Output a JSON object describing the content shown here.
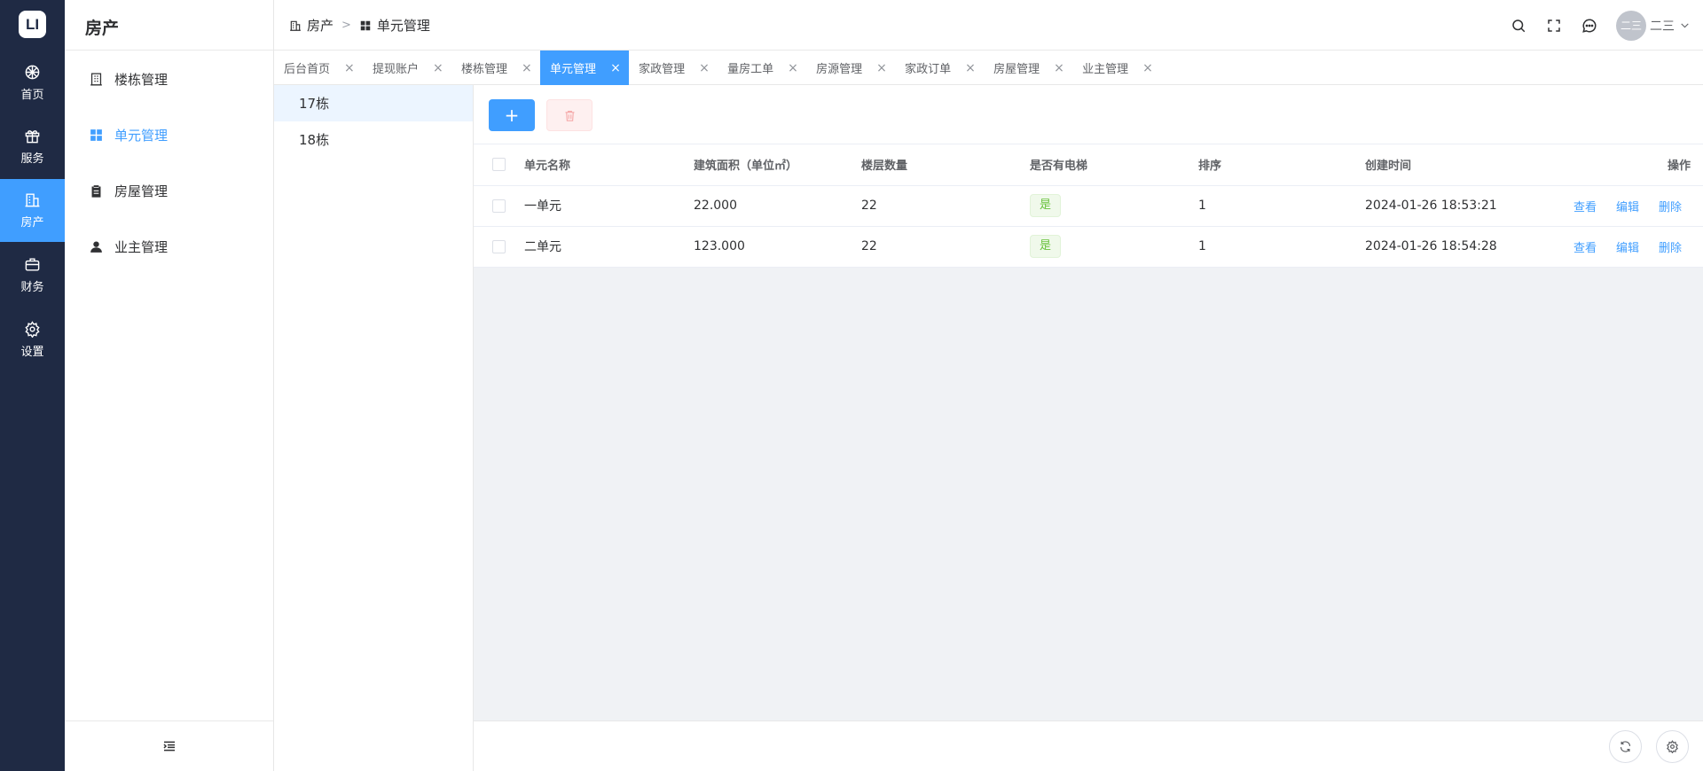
{
  "rail": {
    "logo": "LI",
    "items": [
      {
        "label": "首页",
        "icon": "dashboard-icon"
      },
      {
        "label": "服务",
        "icon": "gift-icon"
      },
      {
        "label": "房产",
        "icon": "building-icon"
      },
      {
        "label": "财务",
        "icon": "briefcase-icon"
      },
      {
        "label": "设置",
        "icon": "gear-icon"
      }
    ]
  },
  "sidebar": {
    "title": "房产",
    "items": [
      {
        "label": "楼栋管理",
        "icon": "office-building-icon"
      },
      {
        "label": "单元管理",
        "icon": "grid-icon"
      },
      {
        "label": "房屋管理",
        "icon": "clipboard-icon"
      },
      {
        "label": "业主管理",
        "icon": "person-icon"
      }
    ]
  },
  "header": {
    "breadcrumb": [
      "房产",
      "单元管理"
    ],
    "user_avatar_text": "二三",
    "user_name": "二三"
  },
  "tabs": [
    {
      "label": "后台首页"
    },
    {
      "label": "提现账户"
    },
    {
      "label": "楼栋管理"
    },
    {
      "label": "单元管理"
    },
    {
      "label": "家政管理"
    },
    {
      "label": "量房工单"
    },
    {
      "label": "房源管理"
    },
    {
      "label": "家政订单"
    },
    {
      "label": "房屋管理"
    },
    {
      "label": "业主管理"
    }
  ],
  "tree": [
    "17栋",
    "18栋"
  ],
  "toolbar": {
    "add_label": "+"
  },
  "table": {
    "columns": [
      "单元名称",
      "建筑面积（单位㎡）",
      "楼层数量",
      "是否有电梯",
      "排序",
      "创建时间",
      "操作"
    ],
    "rows": [
      {
        "name": "一单元",
        "area": "22.000",
        "floors": "22",
        "elevator": "是",
        "sort": "1",
        "created": "2024-01-26 18:53:21"
      },
      {
        "name": "二单元",
        "area": "123.000",
        "floors": "22",
        "elevator": "是",
        "sort": "1",
        "created": "2024-01-26 18:54:28"
      }
    ],
    "actions": {
      "view": "查看",
      "edit": "编辑",
      "delete": "删除"
    }
  },
  "colors": {
    "primary": "#409eff",
    "rail_bg": "#1f2a44",
    "success": "#67c23a"
  }
}
